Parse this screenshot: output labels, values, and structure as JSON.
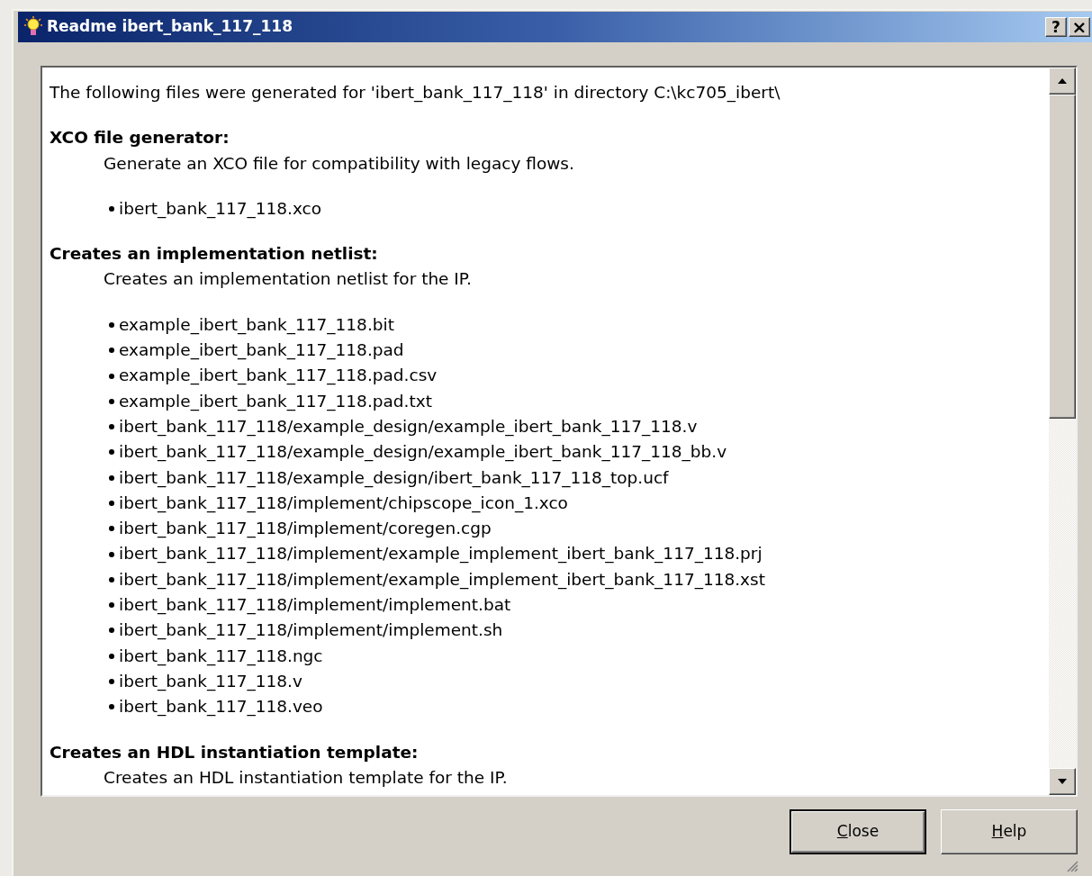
{
  "window": {
    "title": "Readme ibert_bank_117_118",
    "title_buttons": [
      {
        "kind": "help",
        "label": "?"
      },
      {
        "kind": "close",
        "label": "×"
      }
    ]
  },
  "readme": {
    "intro": "The following files were generated for 'ibert_bank_117_118' in directory C:\\kc705_ibert\\",
    "sections": [
      {
        "heading": "XCO file generator:",
        "description": "Generate an XCO file for compatibility with legacy flows.",
        "files": [
          "ibert_bank_117_118.xco"
        ]
      },
      {
        "heading": "Creates an implementation netlist:",
        "description": "Creates an implementation netlist for the IP.",
        "files": [
          "example_ibert_bank_117_118.bit",
          "example_ibert_bank_117_118.pad",
          "example_ibert_bank_117_118.pad.csv",
          "example_ibert_bank_117_118.pad.txt",
          "ibert_bank_117_118/example_design/example_ibert_bank_117_118.v",
          "ibert_bank_117_118/example_design/example_ibert_bank_117_118_bb.v",
          "ibert_bank_117_118/example_design/ibert_bank_117_118_top.ucf",
          "ibert_bank_117_118/implement/chipscope_icon_1.xco",
          "ibert_bank_117_118/implement/coregen.cgp",
          "ibert_bank_117_118/implement/example_implement_ibert_bank_117_118.prj",
          "ibert_bank_117_118/implement/example_implement_ibert_bank_117_118.xst",
          "ibert_bank_117_118/implement/implement.bat",
          "ibert_bank_117_118/implement/implement.sh",
          "ibert_bank_117_118.ngc",
          "ibert_bank_117_118.v",
          "ibert_bank_117_118.veo"
        ]
      },
      {
        "heading": "Creates an HDL instantiation template:",
        "description": "Creates an HDL instantiation template for the IP."
      }
    ]
  },
  "buttons": [
    {
      "label": "Close",
      "default": true,
      "mnemonic_underlined": true
    },
    {
      "label": "Help",
      "default": false,
      "mnemonic_underlined": true
    }
  ]
}
